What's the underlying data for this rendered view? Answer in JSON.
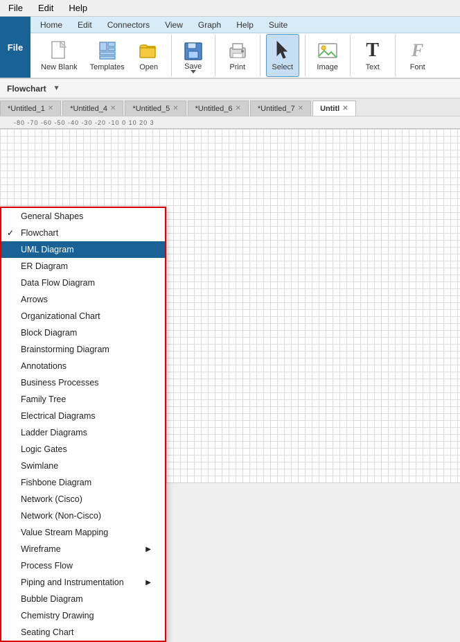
{
  "menubar": {
    "items": [
      "File",
      "Edit",
      "Help"
    ]
  },
  "ribbon": {
    "file_label": "File",
    "tabs": [
      "Home",
      "Edit",
      "Connectors",
      "View",
      "Graph",
      "Help",
      "Suite"
    ],
    "active_tab": "Home",
    "buttons": [
      {
        "label": "New Blank",
        "icon": "📄"
      },
      {
        "label": "Templates",
        "icon": "📋"
      },
      {
        "label": "Open",
        "icon": "📂"
      },
      {
        "label": "Save",
        "icon": "💾"
      },
      {
        "label": "Print",
        "icon": "🖨"
      },
      {
        "label": "Select",
        "icon": "↖"
      },
      {
        "label": "Image",
        "icon": "🖼"
      },
      {
        "label": "Text",
        "icon": "T"
      },
      {
        "label": "Font",
        "icon": "F"
      }
    ]
  },
  "toolbar": {
    "label": "Flowchart"
  },
  "tabs": [
    {
      "label": "Untitled_1",
      "modified": true
    },
    {
      "label": "Untitled_4",
      "modified": true
    },
    {
      "label": "Untitled_5",
      "modified": true
    },
    {
      "label": "Untitled_6",
      "modified": true
    },
    {
      "label": "Untitled_7",
      "modified": true
    },
    {
      "label": "Untitl",
      "modified": false,
      "active": true
    }
  ],
  "dropdown": {
    "items": [
      {
        "label": "General Shapes",
        "checked": false,
        "arrow": false
      },
      {
        "label": "Flowchart",
        "checked": true,
        "arrow": false
      },
      {
        "label": "UML Diagram",
        "checked": false,
        "arrow": false,
        "highlighted": true
      },
      {
        "label": "ER Diagram",
        "checked": false,
        "arrow": false
      },
      {
        "label": "Data Flow Diagram",
        "checked": false,
        "arrow": false
      },
      {
        "label": "Arrows",
        "checked": false,
        "arrow": false
      },
      {
        "label": "Organizational Chart",
        "checked": false,
        "arrow": false
      },
      {
        "label": "Block Diagram",
        "checked": false,
        "arrow": false
      },
      {
        "label": "Brainstorming Diagram",
        "checked": false,
        "arrow": false
      },
      {
        "label": "Annotations",
        "checked": false,
        "arrow": false
      },
      {
        "label": "Business Processes",
        "checked": false,
        "arrow": false
      },
      {
        "label": "Family Tree",
        "checked": false,
        "arrow": false
      },
      {
        "label": "Electrical Diagrams",
        "checked": false,
        "arrow": false
      },
      {
        "label": "Ladder Diagrams",
        "checked": false,
        "arrow": false
      },
      {
        "label": "Logic Gates",
        "checked": false,
        "arrow": false
      },
      {
        "label": "Swimlane",
        "checked": false,
        "arrow": false
      },
      {
        "label": "Fishbone Diagram",
        "checked": false,
        "arrow": false
      },
      {
        "label": "Network (Cisco)",
        "checked": false,
        "arrow": false
      },
      {
        "label": "Network (Non-Cisco)",
        "checked": false,
        "arrow": false
      },
      {
        "label": "Value Stream Mapping",
        "checked": false,
        "arrow": false
      },
      {
        "label": "Wireframe",
        "checked": false,
        "arrow": true
      },
      {
        "label": "Process Flow",
        "checked": false,
        "arrow": false
      },
      {
        "label": "Piping and Instrumentation",
        "checked": false,
        "arrow": true
      },
      {
        "label": "Bubble Diagram",
        "checked": false,
        "arrow": false
      },
      {
        "label": "Chemistry Drawing",
        "checked": false,
        "arrow": false
      },
      {
        "label": "Seating Chart",
        "checked": false,
        "arrow": false
      }
    ]
  },
  "ruler": {
    "marks": "-80  -70  -60  -50  -40  -30  -20  -10   0   10   20   3"
  },
  "statusbar": {
    "text": ""
  }
}
